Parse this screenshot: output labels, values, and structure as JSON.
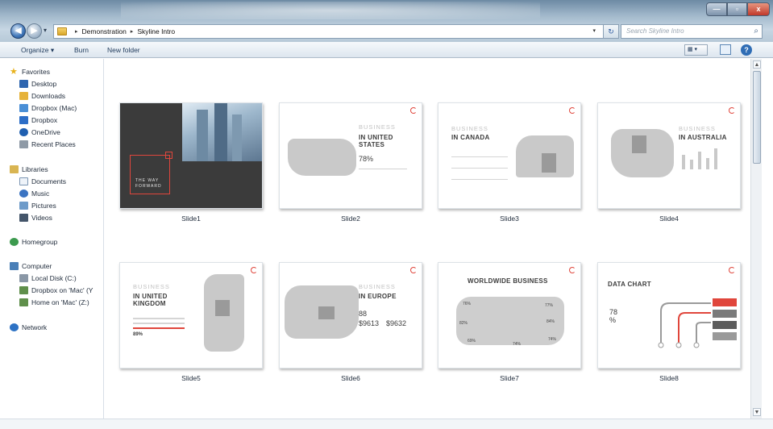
{
  "window": {
    "minimize_glyph": "—",
    "maximize_glyph": "▫",
    "close_glyph": "x"
  },
  "address_bar": {
    "back_glyph": "◀",
    "forward_glyph": "▶",
    "breadcrumb": [
      "Demonstration",
      "Skyline Intro"
    ],
    "separator": "▸",
    "dropdown_glyph": "▾",
    "refresh_glyph": "↻"
  },
  "search": {
    "placeholder": "Search Skyline Intro",
    "icon": "search-icon",
    "icon_glyph": "⌕"
  },
  "toolbar": {
    "organize_label": "Organize ▾",
    "burn_label": "Burn",
    "new_folder_label": "New folder",
    "view_label": "▦ ▾",
    "help_glyph": "?"
  },
  "nav": {
    "favorites": {
      "label": "Favorites",
      "items": [
        "Desktop",
        "Downloads",
        "Dropbox (Mac)",
        "Dropbox",
        "OneDrive",
        "Recent Places"
      ]
    },
    "libraries": {
      "label": "Libraries",
      "items": [
        "Documents",
        "Music",
        "Pictures",
        "Videos"
      ]
    },
    "homegroup": "Homegroup",
    "computer": {
      "label": "Computer",
      "items": [
        "Local Disk (C:)",
        "Dropbox on 'Mac' (Y",
        "Home on 'Mac' (Z:)"
      ]
    },
    "network": "Network"
  },
  "slides": {
    "s1": {
      "label": "Slide1",
      "title_small": "THE WAY",
      "title_small2": "FORWARD"
    },
    "s2": {
      "label": "Slide2",
      "heading_light": "BUSINESS",
      "heading": "IN UNITED STATES",
      "stat": "78%"
    },
    "s3": {
      "label": "Slide3",
      "heading_light": "BUSINESS",
      "heading": "IN CANADA"
    },
    "s4": {
      "label": "Slide4",
      "heading_light": "BUSINESS",
      "heading": "IN AUSTRALIA"
    },
    "s5": {
      "label": "Slide5",
      "heading_light": "BUSINESS",
      "heading": "IN UNITED KINGDOM",
      "stat": "89%"
    },
    "s6": {
      "label": "Slide6",
      "heading_light": "BUSINESS",
      "heading": "IN EUROPE",
      "stat_a": "88",
      "stat_b": "$9613",
      "stat_c": "$9632"
    },
    "s7": {
      "label": "Slide7",
      "heading": "WORLDWIDE BUSINESS",
      "stats": [
        "76%",
        "82%",
        "69%",
        "77%",
        "84%",
        "74%",
        "74%"
      ]
    },
    "s8": {
      "label": "Slide8",
      "heading": "DATA CHART",
      "stat": "78",
      "unit": "%"
    }
  },
  "colors": {
    "accent_red": "#e0463c",
    "slide_dark": "#3b3b3b"
  }
}
